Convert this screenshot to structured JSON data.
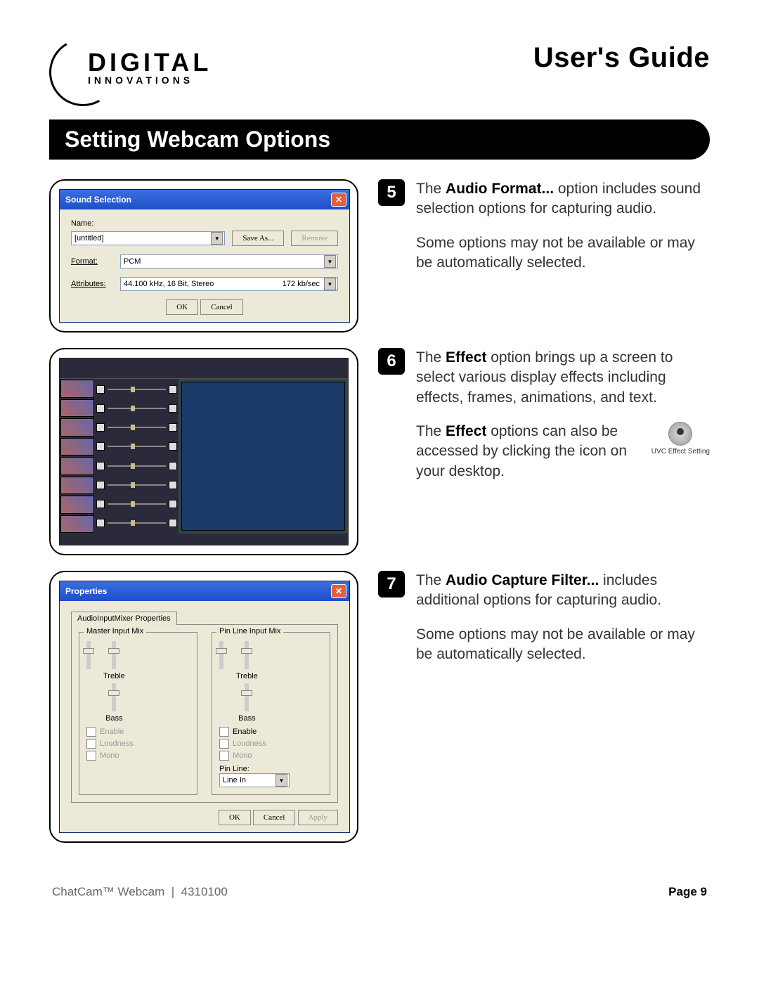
{
  "header": {
    "logo_main": "DIGITAL",
    "logo_sub": "INNOVATIONS",
    "guide_title": "User's Guide"
  },
  "section_title": "Setting Webcam Options",
  "steps": {
    "s5": {
      "num": "5",
      "p1_pre": "The ",
      "p1_bold": "Audio Format...",
      "p1_post": " option includes sound selection options for capturing audio.",
      "p2": "Some options may not be available or may be automatically selected."
    },
    "s6": {
      "num": "6",
      "p1_pre": "The ",
      "p1_bold": "Effect",
      "p1_post": " option brings up a screen to select various display effects including effects, frames, animations, and text.",
      "p2_pre": "The ",
      "p2_bold": "Effect",
      "p2_post": " options can also be accessed by clicking the icon on your desktop.",
      "icon_label": "UVC Effect Setting"
    },
    "s7": {
      "num": "7",
      "p1_pre": "The ",
      "p1_bold": "Audio Capture Filter...",
      "p1_post": " includes additional options for capturing audio.",
      "p2": "Some options may not be available or may be automatically selected."
    }
  },
  "sound_dialog": {
    "title": "Sound Selection",
    "name_label": "Name:",
    "name_value": "[untitled]",
    "save_as": "Save As...",
    "remove": "Remove",
    "format_label": "Format:",
    "format_value": "PCM",
    "attr_label": "Attributes:",
    "attr_value": "44.100 kHz, 16 Bit, Stereo",
    "attr_rate": "172 kb/sec",
    "ok": "OK",
    "cancel": "Cancel"
  },
  "props_dialog": {
    "title": "Properties",
    "tab": "AudioInputMixer Properties",
    "group1": "Master Input Mix",
    "group2": "Pin Line Input Mix",
    "treble": "Treble",
    "bass": "Bass",
    "enable": "Enable",
    "loudness": "Loudness",
    "mono": "Mono",
    "pin_line_label": "Pin Line:",
    "pin_line_value": "Line In",
    "ok": "OK",
    "cancel": "Cancel",
    "apply": "Apply"
  },
  "footer": {
    "product": "ChatCam™ Webcam",
    "model": "4310100",
    "page_label": "Page",
    "page_num": "9"
  }
}
